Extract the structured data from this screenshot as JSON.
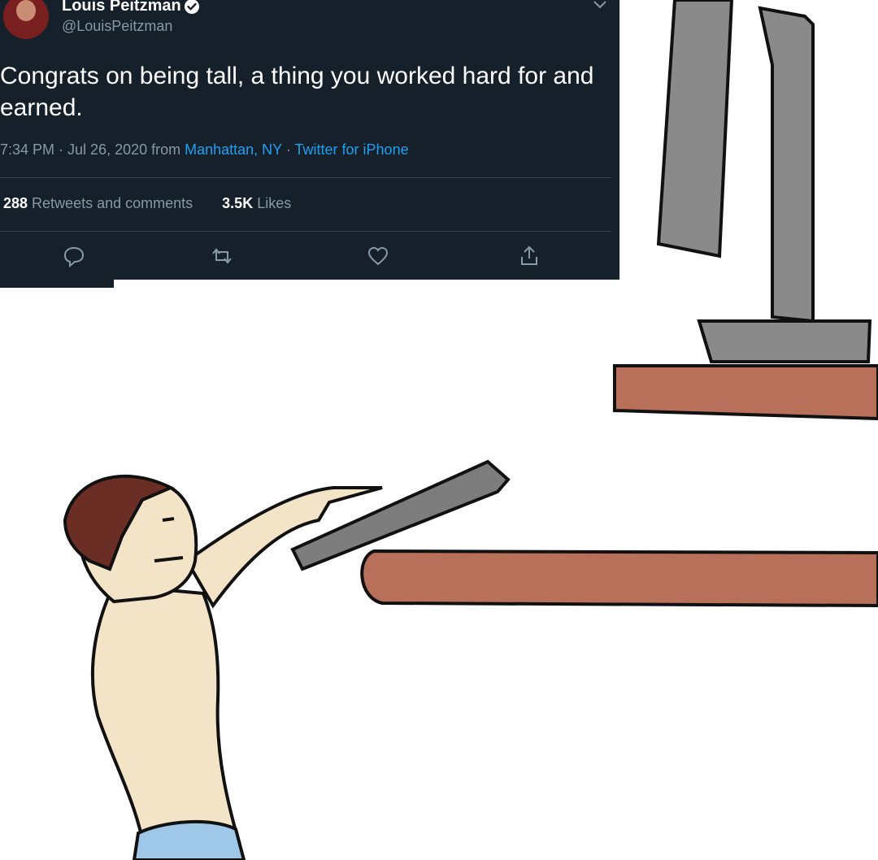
{
  "tweet": {
    "author_name": "Louis Peitzman",
    "author_handle": "@LouisPeitzman",
    "text": "Congrats on being tall, a thing you worked hard for and earned.",
    "timestamp": "7:34 PM · Jul 26, 2020 from ",
    "location": "Manhattan, NY",
    "separator": " · ",
    "source": "Twitter for iPhone",
    "retweets_count": "288",
    "retweets_label": " Retweets and comments",
    "likes_count": "3.5K",
    "likes_label": " Likes"
  },
  "actions": [
    {
      "icon": "reply-icon"
    },
    {
      "icon": "retweet-icon"
    },
    {
      "icon": "like-icon"
    },
    {
      "icon": "share-icon"
    }
  ],
  "colors": {
    "tweet_background": "#15202b",
    "text_primary": "#ffffff",
    "text_secondary": "#8899a6",
    "link": "#1da1f2",
    "shelf": "#b8705a",
    "skin": "#f3e4c8",
    "hair": "#6a2e24",
    "jeans": "#9fc8e8",
    "gray_object": "#8a8a8a"
  }
}
